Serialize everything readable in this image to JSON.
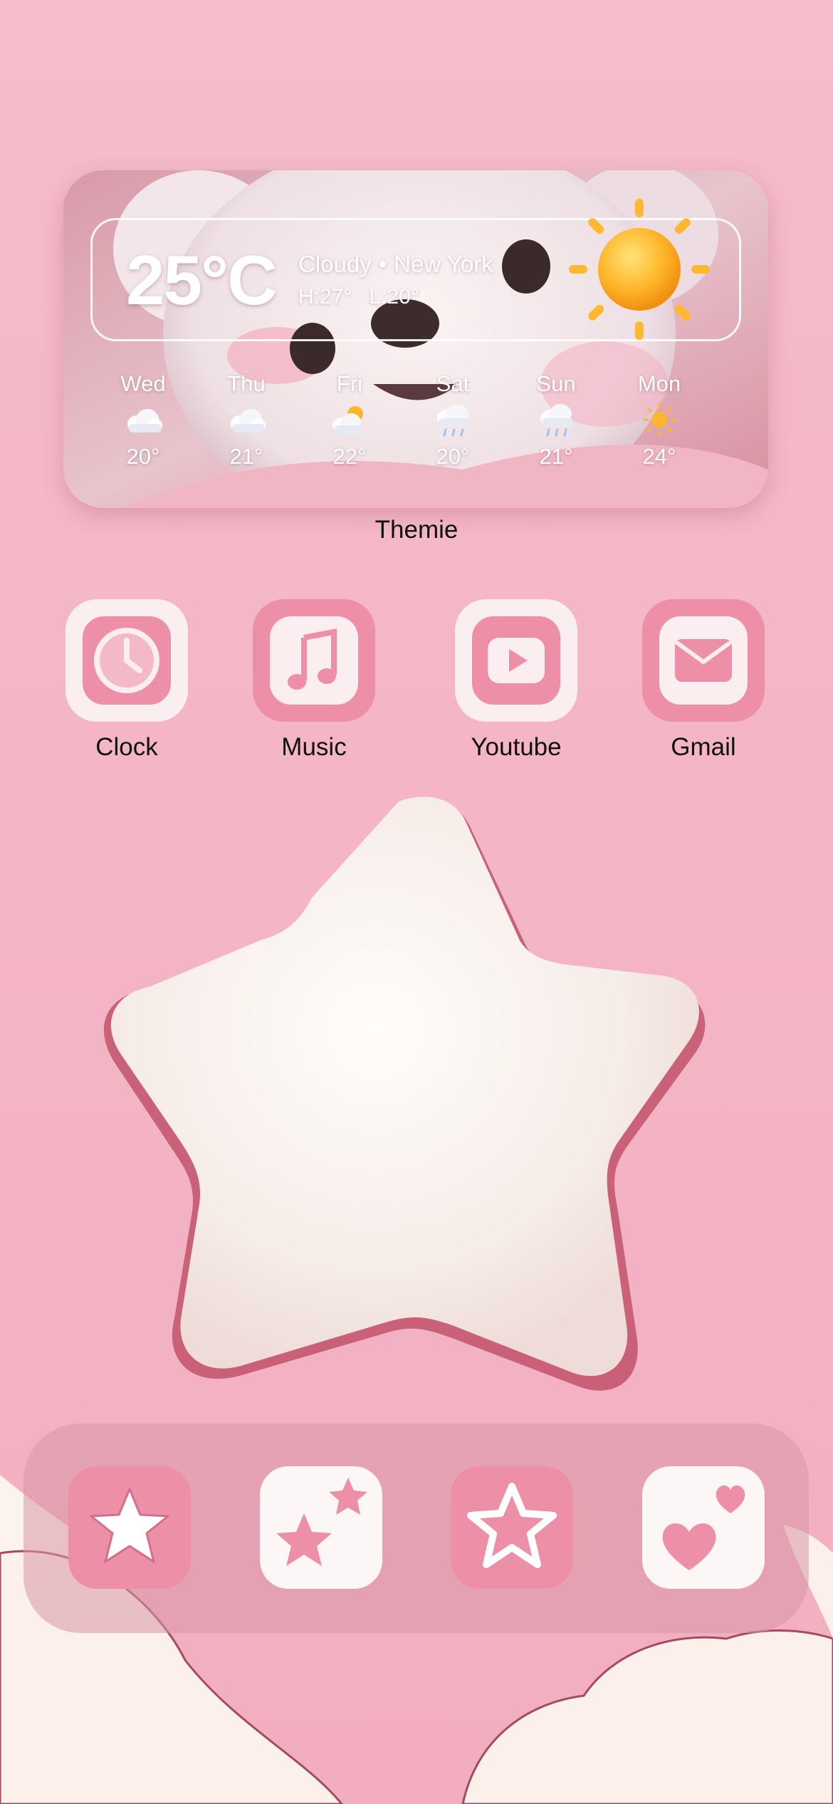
{
  "weather": {
    "temperature": "25°C",
    "condition": "Cloudy",
    "separator": "•",
    "location": "New York",
    "high": "H:27°",
    "low": "L:20°",
    "current_icon": "sun-icon",
    "forecast": [
      {
        "day": "Wed",
        "temp": "20°",
        "icon": "cloud-icon"
      },
      {
        "day": "Thu",
        "temp": "21°",
        "icon": "cloud-icon"
      },
      {
        "day": "Fri",
        "temp": "22°",
        "icon": "partly-cloudy-icon"
      },
      {
        "day": "Sat",
        "temp": "20°",
        "icon": "rain-cloud-icon"
      },
      {
        "day": "Sun",
        "temp": "21°",
        "icon": "rain-cloud-icon"
      },
      {
        "day": "Mon",
        "temp": "24°",
        "icon": "sun-icon"
      }
    ]
  },
  "widget_label": "Themie",
  "apps": [
    {
      "label": "Clock",
      "icon": "clock-icon"
    },
    {
      "label": "Music",
      "icon": "music-note-icon"
    },
    {
      "label": "Youtube",
      "icon": "play-icon"
    },
    {
      "label": "Gmail",
      "icon": "envelope-icon"
    }
  ],
  "dock": [
    {
      "icon": "star-icon"
    },
    {
      "icon": "two-stars-icon"
    },
    {
      "icon": "outlined-star-icon"
    },
    {
      "icon": "two-hearts-icon"
    }
  ],
  "colors": {
    "background": "#f4b7c6",
    "accent_pink": "#ee8fa8",
    "cream": "#fbf2ec"
  }
}
